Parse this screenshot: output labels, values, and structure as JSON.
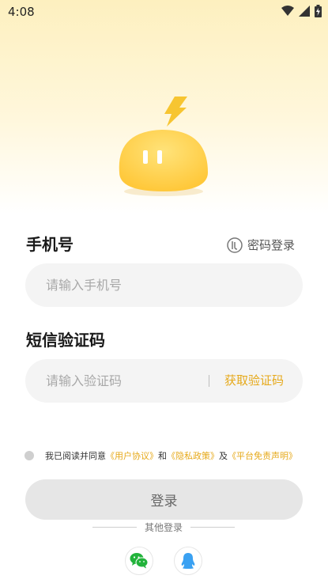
{
  "status_bar": {
    "time": "4:08"
  },
  "login": {
    "phone_label": "手机号",
    "password_login": "密码登录",
    "phone_placeholder": "请输入手机号",
    "sms_label": "短信验证码",
    "code_placeholder": "请输入验证码",
    "get_code": "获取验证码",
    "agreement": {
      "prefix": "我已阅读并同意",
      "user_agreement": "《用户协议》",
      "and": "和",
      "privacy_policy": "《隐私政策》",
      "and2": "及",
      "disclaimer": "《平台免责声明》"
    },
    "login_button": "登录",
    "other_login": "其他登录"
  },
  "colors": {
    "accent": "#e6a91a",
    "mascot": "#ffd54a",
    "bolt": "#f7c531"
  },
  "icons": [
    "wifi-icon",
    "signal-icon",
    "battery-icon",
    "password-icon",
    "wechat-icon",
    "qq-icon"
  ]
}
